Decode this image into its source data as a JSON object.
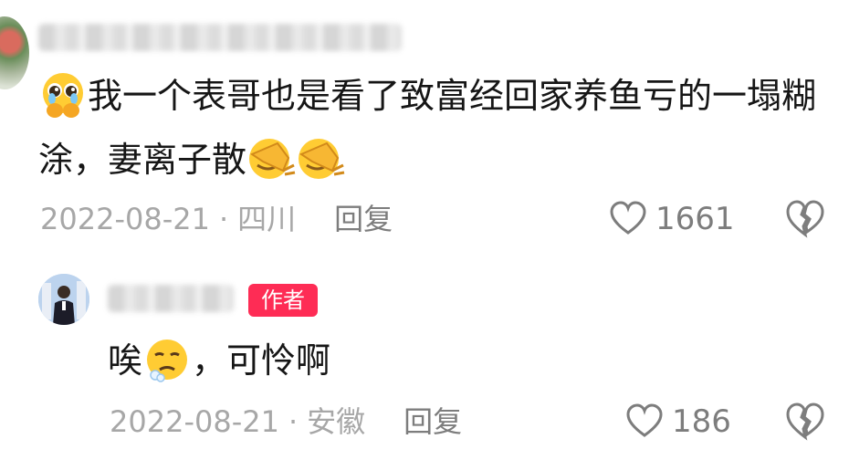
{
  "comments": [
    {
      "text_part1": "我一个表哥也是看了致富经回家养鱼亏的一塌糊涂，妻离子散",
      "date": "2022-08-21",
      "location": "四川",
      "reply_label": "回复",
      "like_count": "1661",
      "icons": [
        "pleading-hands-emoji",
        "facepalm-emoji",
        "facepalm-emoji",
        "heart-icon",
        "broken-heart-icon"
      ]
    },
    {
      "badge": "作者",
      "text_a": "唉",
      "text_b": "，可怜啊",
      "date": "2022-08-21",
      "location": "安徽",
      "reply_label": "回复",
      "like_count": "186",
      "icons": [
        "sad-emoji",
        "heart-icon",
        "broken-heart-icon"
      ]
    }
  ],
  "separator": "·",
  "colors": {
    "author_badge": "#fe2c55",
    "meta_text": "#a7a7a7",
    "action_text": "#7d7d7d"
  }
}
